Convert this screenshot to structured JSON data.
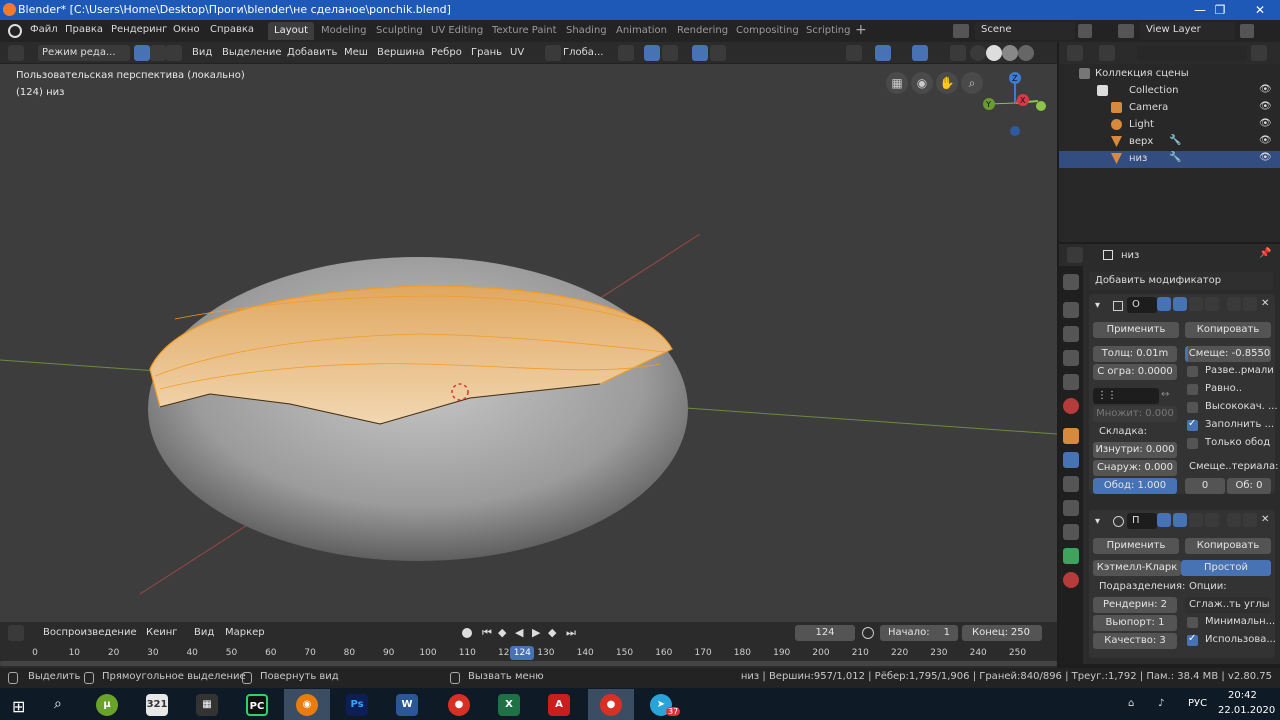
{
  "window": {
    "title": "Blender* [C:\\Users\\Home\\Desktop\\Проги\\blender\\не сделаное\\ponchik.blend]",
    "minimize": "—",
    "maximize": "❐",
    "close": "✕"
  },
  "menu": {
    "items": [
      "Файл",
      "Правка",
      "Рендеринг",
      "Окно",
      "Справка"
    ]
  },
  "workspaces": {
    "tabs": [
      "Layout",
      "Modeling",
      "Sculpting",
      "UV Editing",
      "Texture Paint",
      "Shading",
      "Animation",
      "Rendering",
      "Compositing",
      "Scripting"
    ],
    "active": "Layout",
    "add": "+"
  },
  "scene": {
    "label": "Scene",
    "view_layer": "View Layer"
  },
  "viewport_header": {
    "mode": "Режим реда...",
    "menus": [
      "Вид",
      "Выделение",
      "Добавить",
      "Меш",
      "Вершина",
      "Ребро",
      "Грань",
      "UV"
    ],
    "transform": "Глоба..."
  },
  "viewport": {
    "perspective": "Пользовательская перспектива (локально)",
    "object_info": "(124) низ",
    "gizmo": {
      "z": "Z",
      "y": "Y",
      "x": "X"
    }
  },
  "outliner": {
    "search_placeholder": "",
    "rows": [
      {
        "label": "Коллекция сцены"
      },
      {
        "label": "Collection"
      },
      {
        "label": "Camera"
      },
      {
        "label": "Light"
      },
      {
        "label": "верх"
      },
      {
        "label": "низ"
      }
    ]
  },
  "properties": {
    "object_name": "низ",
    "add_modifier": "Добавить модификатор",
    "solidify": {
      "name": "О",
      "apply": "Применить",
      "copy": "Копировать",
      "thickness": "Толщ: 0.01m",
      "offset": "Смеще: -0.8550",
      "clamp": "С огра: 0.0000",
      "flip_normals": "Разве..рмали",
      "even": "Равно..",
      "high_quality": "Высококач. ...",
      "fill_rim": "Заполнить ...",
      "only_rim": "Только обод",
      "vgroup_icon": "⋮⋮",
      "factor": "Множит: 0.000",
      "crease_label": "Складка:",
      "inner": "Изнутри: 0.000",
      "outer": "Снаруж: 0.000",
      "rim": "Обод: 1.000",
      "material_offset": "Смеще..териала:",
      "mat_value": "0",
      "rim_mat": "Об: 0"
    },
    "subsurf": {
      "name": "П",
      "apply": "Применить",
      "copy": "Копировать",
      "catmull": "Кэтмелл-Кларк",
      "simple": "Простой",
      "subdivisions_label": "Подразделения:",
      "options_label": "Опции:",
      "render": "Рендерин: 2",
      "viewport": "Вьюпорт: 1",
      "quality": "Качество: 3",
      "uv_smooth": "Сглаж..ть углы",
      "optimal": "Минимальн...",
      "use_creases": "Использова..."
    }
  },
  "timeline": {
    "playback": "Воспроизведение",
    "keying": "Кеинг",
    "view": "Вид",
    "markers": "Маркер",
    "current_frame": "124",
    "start_label": "Начало:",
    "start": "1",
    "end_label": "Конец:",
    "end": "250",
    "ticks": [
      "0",
      "10",
      "20",
      "30",
      "40",
      "50",
      "60",
      "70",
      "80",
      "90",
      "100",
      "110",
      "120",
      "130",
      "140",
      "150",
      "160",
      "170",
      "180",
      "190",
      "200",
      "210",
      "220",
      "230",
      "240",
      "250"
    ],
    "playhead": "124"
  },
  "status": {
    "select": "Выделить",
    "box_select": "Прямоугольное выделение",
    "rotate": "Повернуть вид",
    "menu": "Вызвать меню",
    "stats": "низ | Вершин:957/1,012 | Рёбер:1,795/1,906 | Граней:840/896 | Треуг.:1,792 | Пам.: 38.4 MB | v2.80.75"
  },
  "taskbar": {
    "lang": "РУС",
    "time": "20:42",
    "date": "22.01.2020",
    "telegram_badge": "37"
  },
  "colors": {
    "accent": "#4772b3",
    "titlebar": "#1f59b8",
    "selection_orange": "#f39c28",
    "mesh": "#a9a9a9"
  }
}
